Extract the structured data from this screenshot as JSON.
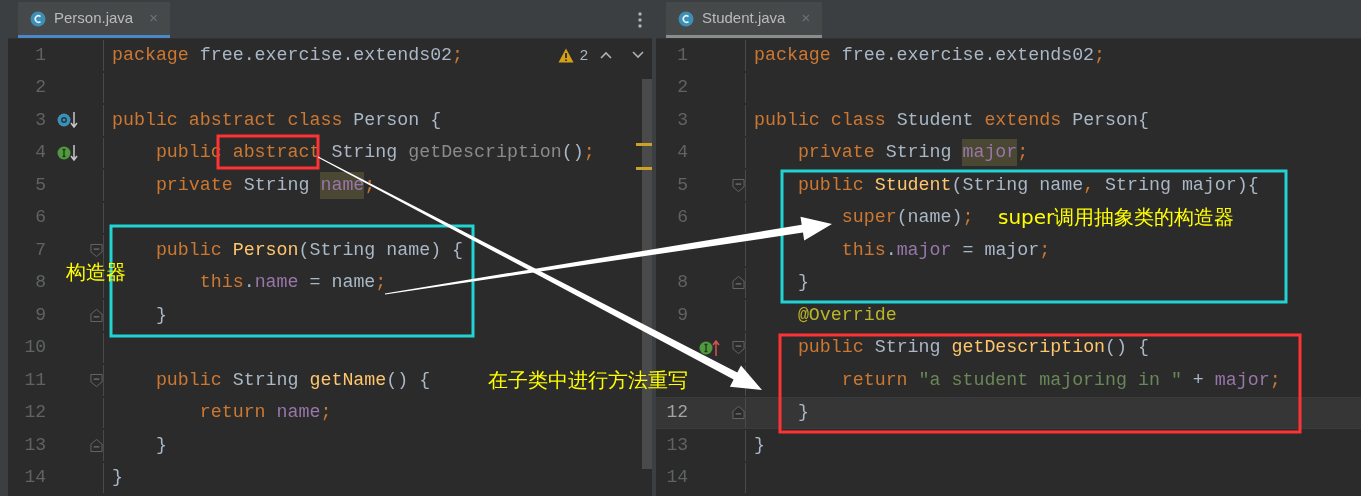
{
  "editors": [
    {
      "tab": {
        "title": "Person.java",
        "close": "×",
        "selected": true,
        "focused": true
      },
      "inspection": {
        "count": "2"
      },
      "lines": [
        {
          "number": "1",
          "current": false,
          "tokens": [
            {
              "kind": "kw",
              "text": "package "
            },
            {
              "kind": "plain",
              "text": "free.exercise.extends02"
            },
            {
              "kind": "kw",
              "text": ";"
            }
          ]
        },
        {
          "number": "2",
          "current": false
        },
        {
          "number": "3",
          "current": false,
          "marker": {
            "kind": "subclassed"
          },
          "tokens": [
            {
              "kind": "kw",
              "text": "public abstract class "
            },
            {
              "kind": "plain",
              "text": "Person {"
            }
          ]
        },
        {
          "number": "4",
          "current": false,
          "marker": {
            "kind": "implemented"
          },
          "tokens": [
            {
              "kind": "kw",
              "text": "    public abstract "
            },
            {
              "kind": "plain",
              "text": "String "
            },
            {
              "kind": "grey",
              "text": "getDescription"
            },
            {
              "kind": "plain",
              "text": "()"
            },
            {
              "kind": "kw",
              "text": ";"
            }
          ]
        },
        {
          "number": "5",
          "current": false,
          "tokens": [
            {
              "kind": "kw",
              "text": "    private "
            },
            {
              "kind": "plain",
              "text": "String "
            },
            {
              "kind": "field_hl",
              "text": "name"
            },
            {
              "kind": "kw",
              "text": ";"
            }
          ]
        },
        {
          "number": "6",
          "current": false
        },
        {
          "number": "7",
          "current": false,
          "fold": {
            "kind": "start"
          },
          "tokens": [
            {
              "kind": "kw",
              "text": "    public "
            },
            {
              "kind": "decl",
              "text": "Person"
            },
            {
              "kind": "plain",
              "text": "(String name) {"
            }
          ]
        },
        {
          "number": "8",
          "current": false,
          "tokens": [
            {
              "kind": "kw",
              "text": "        this"
            },
            {
              "kind": "plain",
              "text": "."
            },
            {
              "kind": "field",
              "text": "name"
            },
            {
              "kind": "plain",
              "text": " = name"
            },
            {
              "kind": "kw",
              "text": ";"
            }
          ]
        },
        {
          "number": "9",
          "current": false,
          "fold": {
            "kind": "end"
          },
          "tokens": [
            {
              "kind": "plain",
              "text": "    }"
            }
          ]
        },
        {
          "number": "10",
          "current": false
        },
        {
          "number": "11",
          "current": false,
          "fold": {
            "kind": "start"
          },
          "tokens": [
            {
              "kind": "kw",
              "text": "    public "
            },
            {
              "kind": "plain",
              "text": "String "
            },
            {
              "kind": "decl",
              "text": "getName"
            },
            {
              "kind": "plain",
              "text": "() {"
            }
          ]
        },
        {
          "number": "12",
          "current": false,
          "tokens": [
            {
              "kind": "kw",
              "text": "        return "
            },
            {
              "kind": "field",
              "text": "name"
            },
            {
              "kind": "kw",
              "text": ";"
            }
          ]
        },
        {
          "number": "13",
          "current": false,
          "fold": {
            "kind": "end"
          },
          "tokens": [
            {
              "kind": "plain",
              "text": "    }"
            }
          ]
        },
        {
          "number": "14",
          "current": false,
          "tokens": [
            {
              "kind": "plain",
              "text": "}"
            }
          ]
        }
      ]
    },
    {
      "tab": {
        "title": "Student.java",
        "close": "×",
        "selected": true,
        "focused": false
      },
      "lines": [
        {
          "number": "1",
          "current": false,
          "tokens": [
            {
              "kind": "kw",
              "text": "package "
            },
            {
              "kind": "plain",
              "text": "free.exercise.extends02"
            },
            {
              "kind": "kw",
              "text": ";"
            }
          ]
        },
        {
          "number": "2",
          "current": false
        },
        {
          "number": "3",
          "current": false,
          "tokens": [
            {
              "kind": "kw",
              "text": "public class "
            },
            {
              "kind": "plain",
              "text": "Student "
            },
            {
              "kind": "kw",
              "text": "extends "
            },
            {
              "kind": "plain",
              "text": "Person{"
            }
          ]
        },
        {
          "number": "4",
          "current": false,
          "tokens": [
            {
              "kind": "kw",
              "text": "    private "
            },
            {
              "kind": "plain",
              "text": "String "
            },
            {
              "kind": "field_hl",
              "text": "major"
            },
            {
              "kind": "kw",
              "text": ";"
            }
          ]
        },
        {
          "number": "5",
          "current": false,
          "fold": {
            "kind": "start"
          },
          "tokens": [
            {
              "kind": "kw",
              "text": "    public "
            },
            {
              "kind": "decl",
              "text": "Student"
            },
            {
              "kind": "plain",
              "text": "(String name"
            },
            {
              "kind": "kw",
              "text": ", "
            },
            {
              "kind": "plain",
              "text": "String major){"
            }
          ]
        },
        {
          "number": "6",
          "current": false,
          "tokens": [
            {
              "kind": "kw",
              "text": "        super"
            },
            {
              "kind": "plain",
              "text": "(name)"
            },
            {
              "kind": "kw",
              "text": ";"
            }
          ]
        },
        {
          "current": false,
          "tokens": [
            {
              "kind": "kw",
              "text": "        this"
            },
            {
              "kind": "plain",
              "text": "."
            },
            {
              "kind": "field",
              "text": "major"
            },
            {
              "kind": "plain",
              "text": " = major"
            },
            {
              "kind": "kw",
              "text": ";"
            }
          ]
        },
        {
          "number": "8",
          "current": false,
          "fold": {
            "kind": "end"
          },
          "tokens": [
            {
              "kind": "plain",
              "text": "    }"
            }
          ]
        },
        {
          "number": "9",
          "current": false,
          "tokens": [
            {
              "kind": "anno",
              "text": "    @Override"
            }
          ]
        },
        {
          "current": false,
          "fold": {
            "kind": "start"
          },
          "marker": {
            "kind": "implements"
          },
          "tokens": [
            {
              "kind": "kw",
              "text": "    public "
            },
            {
              "kind": "plain",
              "text": "String "
            },
            {
              "kind": "decl",
              "text": "getDescription"
            },
            {
              "kind": "plain",
              "text": "() {"
            }
          ]
        },
        {
          "current": false,
          "tokens": [
            {
              "kind": "kw",
              "text": "        return "
            },
            {
              "kind": "str",
              "text": "\"a student majoring in \""
            },
            {
              "kind": "plain",
              "text": " + "
            },
            {
              "kind": "field",
              "text": "major"
            },
            {
              "kind": "kw",
              "text": ";"
            }
          ]
        },
        {
          "number": "12",
          "current": true,
          "fold": {
            "kind": "end"
          },
          "tokens": [
            {
              "kind": "plain",
              "text": "    }"
            }
          ]
        },
        {
          "number": "13",
          "current": false,
          "tokens": [
            {
              "kind": "plain",
              "text": "}"
            }
          ]
        },
        {
          "number": "14",
          "current": false
        }
      ]
    }
  ],
  "annotations": [
    {
      "kind": "box",
      "color": "#ff3333"
    },
    {
      "kind": "box",
      "color": "#22d3d3"
    },
    {
      "kind": "box",
      "color": "#22d3d3"
    },
    {
      "kind": "box",
      "color": "#ff3333"
    },
    {
      "kind": "arrow",
      "color": "#ffffff"
    },
    {
      "kind": "arrow",
      "color": "#ffffff"
    },
    {
      "kind": "label",
      "text": "构造器",
      "color": "#ffff00"
    },
    {
      "kind": "label",
      "text": "super调用抽象类的构造器",
      "color": "#ffff00"
    },
    {
      "kind": "label",
      "text": "在子类中进行方法重写",
      "color": "#ffff00"
    }
  ]
}
